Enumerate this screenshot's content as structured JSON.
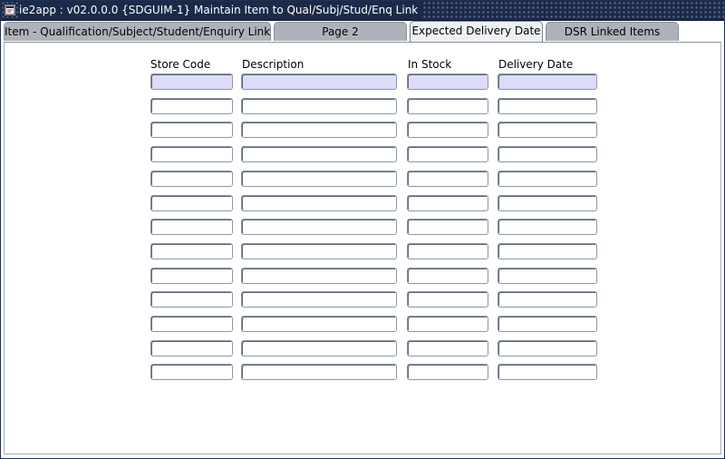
{
  "window": {
    "title": "ie2app : v02.0.0.0 {SDGUIM-1} Maintain Item to Qual/Subj/Stud/Enq Link",
    "icon": "app-window-icon"
  },
  "tabs": [
    {
      "label": "Item - Qualification/Subject/Student/Enquiry Link",
      "active": false
    },
    {
      "label": "Page 2",
      "active": false
    },
    {
      "label": "Expected Delivery Date",
      "active": true
    },
    {
      "label": "DSR Linked Items",
      "active": false
    }
  ],
  "table": {
    "columns": [
      "Store Code",
      "Description",
      "In Stock",
      "Delivery Date"
    ],
    "rows": [
      [
        "",
        "",
        "",
        ""
      ],
      [
        "",
        "",
        "",
        ""
      ],
      [
        "",
        "",
        "",
        ""
      ],
      [
        "",
        "",
        "",
        ""
      ],
      [
        "",
        "",
        "",
        ""
      ],
      [
        "",
        "",
        "",
        ""
      ],
      [
        "",
        "",
        "",
        ""
      ],
      [
        "",
        "",
        "",
        ""
      ],
      [
        "",
        "",
        "",
        ""
      ],
      [
        "",
        "",
        "",
        ""
      ],
      [
        "",
        "",
        "",
        ""
      ],
      [
        "",
        "",
        "",
        ""
      ],
      [
        "",
        "",
        "",
        ""
      ]
    ],
    "current_row": 0
  },
  "colors": {
    "title_bg": "#1c2a48",
    "tab_bg": "#aeb3bb",
    "active_tab_bg": "#eef0f3",
    "current_row_bg": "#dcdcfa"
  }
}
